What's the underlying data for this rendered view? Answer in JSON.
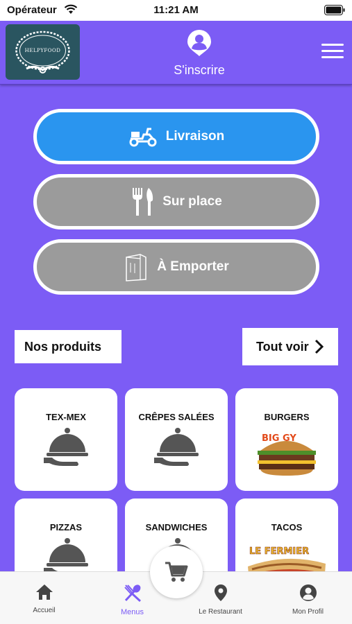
{
  "status_bar": {
    "carrier": "Opérateur",
    "time": "11:21 AM"
  },
  "header": {
    "logo_text": "HELPYFOOD",
    "signup_label": "S'inscrire"
  },
  "modes": {
    "delivery": "Livraison",
    "onsite": "Sur place",
    "takeaway": "À Emporter"
  },
  "section": {
    "title": "Nos produits",
    "see_all": "Tout voir"
  },
  "categories": [
    {
      "label": "TEX-MEX",
      "icon": "cloche-icon"
    },
    {
      "label": "CRÊPES SALÉES",
      "icon": "cloche-icon"
    },
    {
      "label": "BURGERS",
      "icon": "burger-photo"
    },
    {
      "label": "PIZZAS",
      "icon": "cloche-icon"
    },
    {
      "label": "SANDWICHES",
      "icon": "cloche-icon"
    },
    {
      "label": "TACOS",
      "icon": "tacos-photo"
    }
  ],
  "food_image_text": {
    "burger": "BIG GY",
    "tacos": "LE FERMIER"
  },
  "bottom_nav": {
    "home": "Accueil",
    "menus": "Menus",
    "restaurant": "Le Restaurant",
    "profile": "Mon Profil"
  },
  "colors": {
    "background": "#7c5cf5",
    "delivery_button": "#2a95ef",
    "inactive_button": "#9b9b9b",
    "active_nav": "#7c5cf5"
  }
}
